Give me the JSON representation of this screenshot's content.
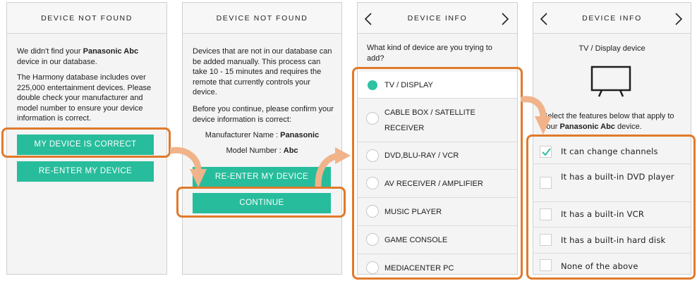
{
  "screen1": {
    "title": "DEVICE NOT FOUND",
    "para1_a": "We didn't find your ",
    "para1_brand": "Panasonic Abc",
    "para1_b": " device in our database.",
    "para2": "The Harmony database includes over 225,000 entertainment devices. Please double check your manufacturer and model number to ensure your device information is correct.",
    "btn_correct": "MY DEVICE IS CORRECT",
    "btn_reenter": "RE-ENTER MY DEVICE"
  },
  "screen2": {
    "title": "DEVICE NOT FOUND",
    "para1": "Devices that are not in our database can be added manually. This process can take 10 - 15 minutes and requires the remote that currently controls your device.",
    "para2": "Before you continue, please confirm your device information is correct:",
    "manufacturer_label": "Manufacturer Name : ",
    "manufacturer_value": "Panasonic",
    "model_label": "Model Number : ",
    "model_value": "Abc",
    "btn_reenter": "RE-ENTER MY DEVICE",
    "btn_continue": "CONTINUE"
  },
  "screen3": {
    "title": "DEVICE INFO",
    "question": "What kind of device are you trying to add?",
    "options": [
      {
        "label": "TV / DISPLAY",
        "selected": true
      },
      {
        "label": "CABLE BOX / SATELLITE RECEIVER",
        "selected": false
      },
      {
        "label": "DVD,BLU-RAY / VCR",
        "selected": false
      },
      {
        "label": "AV RECEIVER / AMPLIFIER",
        "selected": false
      },
      {
        "label": "MUSIC PLAYER",
        "selected": false
      },
      {
        "label": "GAME CONSOLE",
        "selected": false
      },
      {
        "label": "MEDIACENTER PC",
        "selected": false
      }
    ]
  },
  "screen4": {
    "title": "DEVICE INFO",
    "subtitle": "TV / Display device",
    "select_a": "Select the features below that apply to your ",
    "select_brand": "Panasonic Abc",
    "select_b": " device.",
    "features": [
      {
        "label": "It can change channels",
        "checked": true
      },
      {
        "label": "It has a built-in DVD player",
        "checked": false
      },
      {
        "label": "It has a built-in VCR",
        "checked": false
      },
      {
        "label": "It has a built-in hard disk",
        "checked": false
      },
      {
        "label": "None of the above",
        "checked": false
      }
    ]
  },
  "colors": {
    "accent": "#27bd9c",
    "highlight": "#e07a2b",
    "check": "#2fc2a2"
  },
  "icons": [
    "chevron-left-icon",
    "chevron-right-icon",
    "tv-icon",
    "checkmark-icon",
    "arrow-icon"
  ]
}
